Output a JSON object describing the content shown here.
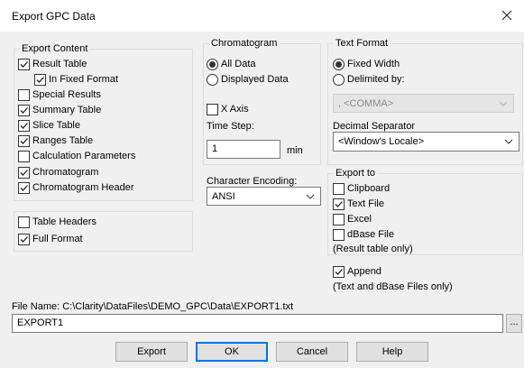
{
  "window": {
    "title": "Export GPC Data"
  },
  "export_content": {
    "legend": "Export Content",
    "items": [
      {
        "label": "Result Table",
        "checked": true
      },
      {
        "label": "In Fixed Format",
        "checked": true
      },
      {
        "label": "Special Results",
        "checked": false
      },
      {
        "label": "Summary Table",
        "checked": true
      },
      {
        "label": "Slice Table",
        "checked": true
      },
      {
        "label": "Ranges Table",
        "checked": true
      },
      {
        "label": "Calculation Parameters",
        "checked": false
      },
      {
        "label": "Chromatogram",
        "checked": true
      },
      {
        "label": "Chromatogram Header",
        "checked": true
      }
    ]
  },
  "table_options": {
    "items": [
      {
        "label": "Table Headers",
        "checked": false
      },
      {
        "label": "Full Format",
        "checked": true
      }
    ]
  },
  "chromatogram": {
    "legend": "Chromatogram",
    "all_data_label": "All Data",
    "displayed_data_label": "Displayed Data",
    "selected": "All Data",
    "x_axis_label": "X Axis",
    "x_axis_checked": false,
    "time_step_label": "Time Step:",
    "time_step_value": "1",
    "time_step_unit": "min"
  },
  "character_encoding": {
    "label": "Character Encoding:",
    "value": "ANSI"
  },
  "text_format": {
    "legend": "Text Format",
    "fixed_width_label": "Fixed Width",
    "delimited_label": "Delimited by:",
    "selected": "Fixed Width",
    "delimiter_value": ", <COMMA>",
    "decimal_separator_label": "Decimal Separator",
    "decimal_separator_value": "<Window's Locale>"
  },
  "export_to": {
    "legend": "Export to",
    "items": [
      {
        "label": "Clipboard",
        "checked": false
      },
      {
        "label": "Text File",
        "checked": true
      },
      {
        "label": "Excel",
        "checked": false
      },
      {
        "label": "dBase File",
        "checked": false
      }
    ],
    "note": "(Result table only)"
  },
  "append": {
    "label": "Append",
    "checked": true,
    "note": "(Text and dBase Files only)"
  },
  "file": {
    "label": "File Name: C:\\Clarity\\DataFiles\\DEMO_GPC\\Data\\EXPORT1.txt",
    "value": "EXPORT1",
    "browse_label": "..."
  },
  "buttons": {
    "export": "Export",
    "ok": "OK",
    "cancel": "Cancel",
    "help": "Help"
  }
}
